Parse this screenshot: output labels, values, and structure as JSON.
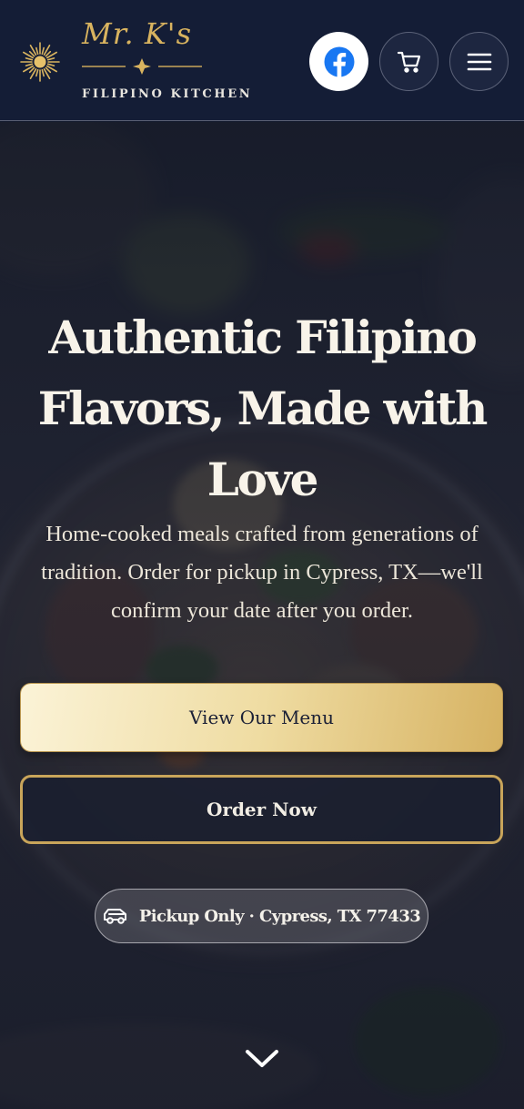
{
  "brand": {
    "name": "Mr. K's",
    "tagline": "FILIPINO KITCHEN",
    "logo_icon": "sun-icon",
    "accent_color": "#d8b35f",
    "header_color": "#141d36"
  },
  "header": {
    "buttons": [
      {
        "name": "facebook",
        "icon": "facebook-icon",
        "color": "#1877f2"
      },
      {
        "name": "cart",
        "icon": "cart-icon"
      },
      {
        "name": "menu",
        "icon": "hamburger-icon"
      }
    ]
  },
  "hero": {
    "title_lines": [
      "Authentic Filipino",
      "Flavors, Made with",
      "Love"
    ],
    "subtitle_lines": [
      "Home-cooked meals crafted from generations of",
      "tradition. Order for pickup in Cypress, TX—we'll",
      "confirm your date after you order."
    ],
    "primary_cta": "View Our Menu",
    "secondary_cta": "Order Now",
    "pickup_badge": "Pickup Only · Cypress, TX 77433",
    "pickup_icon": "truck-icon",
    "scroll_icon": "chevron-down-icon"
  }
}
